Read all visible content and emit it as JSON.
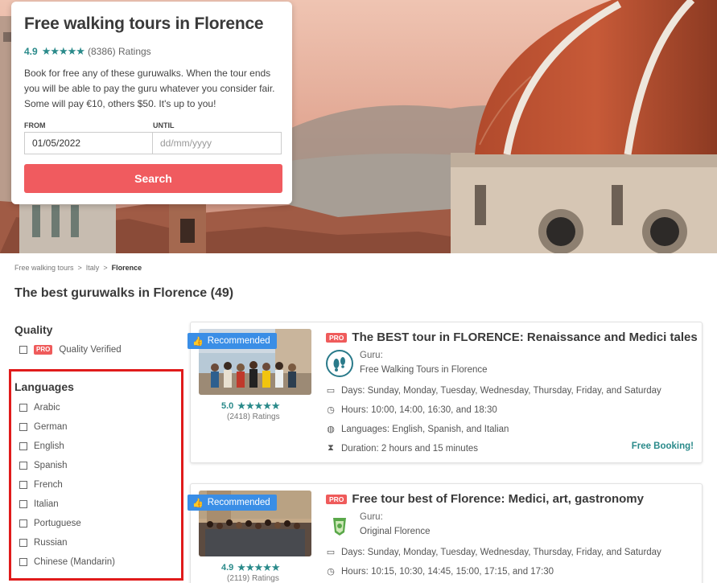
{
  "hero": {
    "title": "Free walking tours in Florence",
    "rating": "4.9",
    "stars": "★★★★★",
    "ratings_count": "(8386) Ratings",
    "description": "Book for free any of these guruwalks. When the tour ends you will be able to pay the guru whatever you consider fair. Some will pay €10, others $50. It's up to you!",
    "from_label": "FROM",
    "until_label": "UNTIL",
    "from_value": "01/05/2022",
    "until_placeholder": "dd/mm/yyyy",
    "search_label": "Search"
  },
  "breadcrumb": {
    "items": [
      "Free walking tours",
      "Italy",
      "Florence"
    ],
    "separator": ">"
  },
  "page_title": "The best guruwalks in Florence (49)",
  "filters": {
    "quality": {
      "title": "Quality",
      "badge": "PRO",
      "option": "Quality Verified"
    },
    "languages": {
      "title": "Languages",
      "options": [
        "Arabic",
        "German",
        "English",
        "Spanish",
        "French",
        "Italian",
        "Portuguese",
        "Russian",
        "Chinese (Mandarin)"
      ]
    }
  },
  "tours": [
    {
      "badge": "Recommended",
      "pro": "PRO",
      "title": "The BEST tour in FLORENCE: Renaissance and Medici tales",
      "rating": "5.0",
      "stars": "★★★★★",
      "ratings_count": "(2418) Ratings",
      "guru_label": "Guru:",
      "guru_name": "Free Walking Tours in Florence",
      "days": "Days: Sunday, Monday, Tuesday, Wednesday, Thursday, Friday, and Saturday",
      "hours": "Hours: 10:00, 14:00, 16:30, and 18:30",
      "languages": "Languages: English, Spanish, and Italian",
      "duration": "Duration: 2 hours and 15 minutes",
      "booking": "Free Booking!"
    },
    {
      "badge": "Recommended",
      "pro": "PRO",
      "title": "Free tour best of Florence: Medici, art, gastronomy",
      "rating": "4.9",
      "stars": "★★★★★",
      "ratings_count": "(2119) Ratings",
      "guru_label": "Guru:",
      "guru_name": "Original Florence",
      "days": "Days: Sunday, Monday, Tuesday, Wednesday, Thursday, Friday, and Saturday",
      "hours": "Hours: 10:15, 10:30, 14:45, 15:00, 17:15, and 17:30"
    }
  ],
  "colors": {
    "accent": "#f05b5f",
    "teal": "#2a8a8a",
    "recommended": "#3a8ee6",
    "highlight_frame": "#e01b1b"
  }
}
